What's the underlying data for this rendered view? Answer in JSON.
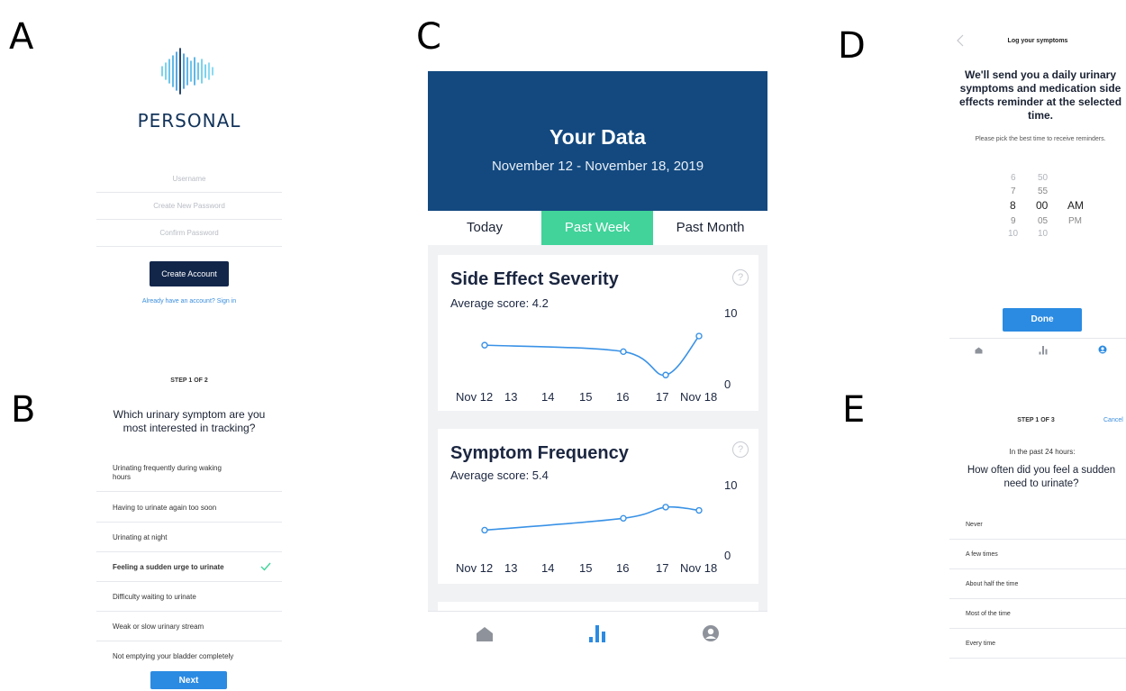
{
  "colors": {
    "accent": "#2b8be2",
    "navy": "#13497f",
    "active_tab": "#41d39a",
    "dark_button": "#12264a",
    "line": "#3a92e6"
  },
  "panel_letters": [
    "A",
    "B",
    "C",
    "D",
    "E"
  ],
  "panel_a": {
    "logo_icon": "sound-wave-icon",
    "logo_text": "PERSONAL",
    "fields": [
      {
        "placeholder": "Username"
      },
      {
        "placeholder": "Create New Password"
      },
      {
        "placeholder": "Confirm Password"
      }
    ],
    "create_button": "Create Account",
    "sign_in_link": "Already have an account? Sign in"
  },
  "panel_b": {
    "step": "STEP 1 OF 2",
    "question": "Which urinary symptom are you most interested in tracking?",
    "options": [
      {
        "label": "Urinating frequently during waking hours",
        "selected": false
      },
      {
        "label": "Having to urinate again too soon",
        "selected": false
      },
      {
        "label": "Urinating at night",
        "selected": false
      },
      {
        "label": "Feeling a sudden urge to urinate",
        "selected": true
      },
      {
        "label": "Difficulty waiting to urinate",
        "selected": false
      },
      {
        "label": "Weak or slow urinary stream",
        "selected": false
      },
      {
        "label": "Not emptying your bladder completely",
        "selected": false
      }
    ],
    "next_button": "Next"
  },
  "panel_c": {
    "title": "Your Data",
    "date_range": "November 12 - November 18, 2019",
    "tabs": [
      {
        "label": "Today",
        "active": false
      },
      {
        "label": "Past Week",
        "active": true
      },
      {
        "label": "Past Month",
        "active": false
      }
    ],
    "nav_icons": [
      "home-icon",
      "bar-chart-icon",
      "user-circle-icon"
    ],
    "help_icon": "?"
  },
  "chart_data": [
    {
      "type": "line",
      "title": "Side Effect Severity",
      "subtitle": "Average score: 4.2",
      "categories": [
        "Nov 12",
        "13",
        "14",
        "15",
        "16",
        "17",
        "Nov 18"
      ],
      "points": [
        {
          "x": "Nov 12",
          "y": 5.4
        },
        {
          "x": "16",
          "y": 4.4
        },
        {
          "x": "17",
          "y": 0.8
        },
        {
          "x": "Nov 18",
          "y": 6.8
        }
      ],
      "ylim": [
        0,
        10
      ],
      "yticks": [
        "10",
        "0"
      ]
    },
    {
      "type": "line",
      "title": "Symptom Frequency",
      "subtitle": "Average score: 5.4",
      "categories": [
        "Nov 12",
        "13",
        "14",
        "15",
        "16",
        "17",
        "Nov 18"
      ],
      "points": [
        {
          "x": "Nov 12",
          "y": 3.5
        },
        {
          "x": "16",
          "y": 5.3
        },
        {
          "x": "17",
          "y": 7.0
        },
        {
          "x": "Nov 18",
          "y": 6.5
        }
      ],
      "ylim": [
        0,
        10
      ],
      "yticks": [
        "10",
        "0"
      ]
    }
  ],
  "panel_d": {
    "back_icon": "chevron-left-icon",
    "header": "Log your symptoms",
    "title": "We'll send you a daily urinary symptoms and medication side effects reminder at the selected time.",
    "subtitle": "Please pick the best time to receive reminders.",
    "picker": {
      "hours": [
        "6",
        "7",
        "8",
        "9",
        "10"
      ],
      "minutes": [
        "50",
        "55",
        "00",
        "05",
        "10"
      ],
      "periods": [
        "AM",
        "PM"
      ],
      "selected": {
        "hour": "8",
        "minute": "00",
        "period": "AM"
      }
    },
    "done_button": "Done",
    "nav_icons": [
      "home-icon",
      "bar-chart-icon",
      "user-circle-icon"
    ]
  },
  "panel_e": {
    "step": "STEP 1 OF 3",
    "cancel": "Cancel",
    "context": "In the past 24 hours:",
    "question": "How often did you feel a sudden need to urinate?",
    "options": [
      "Never",
      "A few times",
      "About half the time",
      "Most of the time",
      "Every time"
    ]
  }
}
